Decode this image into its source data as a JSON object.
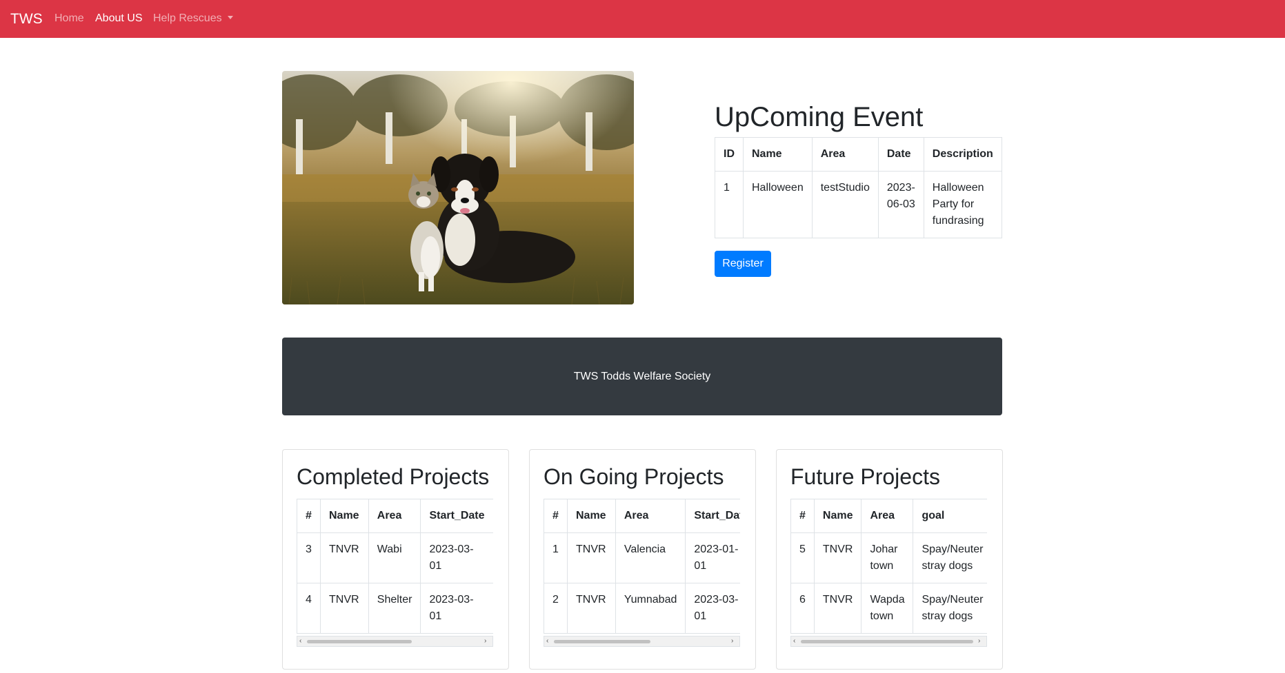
{
  "navbar": {
    "brand": "TWS",
    "links": [
      {
        "label": "Home"
      },
      {
        "label": "About US"
      },
      {
        "label": "Help Rescues"
      }
    ]
  },
  "event": {
    "title": "UpComing Event",
    "headers": [
      "ID",
      "Name",
      "Area",
      "Date",
      "Description"
    ],
    "rows": [
      {
        "id": "1",
        "name": "Halloween",
        "area": "testStudio",
        "date": "2023-06-03",
        "description": "Halloween Party for fundrasing"
      }
    ],
    "register_label": "Register"
  },
  "banner": {
    "text": "TWS Todds Welfare Society"
  },
  "projects": {
    "completed": {
      "title": "Completed Projects",
      "headers": [
        "#",
        "Name",
        "Area",
        "Start_Date"
      ],
      "rows": [
        [
          "3",
          "TNVR",
          "Wabi",
          "2023-03-01"
        ],
        [
          "4",
          "TNVR",
          "Shelter",
          "2023-03-01"
        ]
      ]
    },
    "ongoing": {
      "title": "On Going Projects",
      "headers": [
        "#",
        "Name",
        "Area",
        "Start_Date"
      ],
      "rows": [
        [
          "1",
          "TNVR",
          "Valencia",
          "2023-01-01"
        ],
        [
          "2",
          "TNVR",
          "Yumnabad",
          "2023-03-01"
        ]
      ]
    },
    "future": {
      "title": "Future Projects",
      "headers": [
        "#",
        "Name",
        "Area",
        "goal"
      ],
      "rows": [
        [
          "5",
          "TNVR",
          "Johar town",
          "Spay/Neuter stray dogs"
        ],
        [
          "6",
          "TNVR",
          "Wapda town",
          "Spay/Neuter stray dogs"
        ]
      ]
    }
  },
  "colors": {
    "navbar": "#dc3545",
    "primary_button": "#007bff",
    "banner": "#343a40"
  },
  "icons": {
    "dropdown": "caret-down-icon",
    "scroll_left": "chevron-left-icon",
    "scroll_right": "chevron-right-icon"
  }
}
